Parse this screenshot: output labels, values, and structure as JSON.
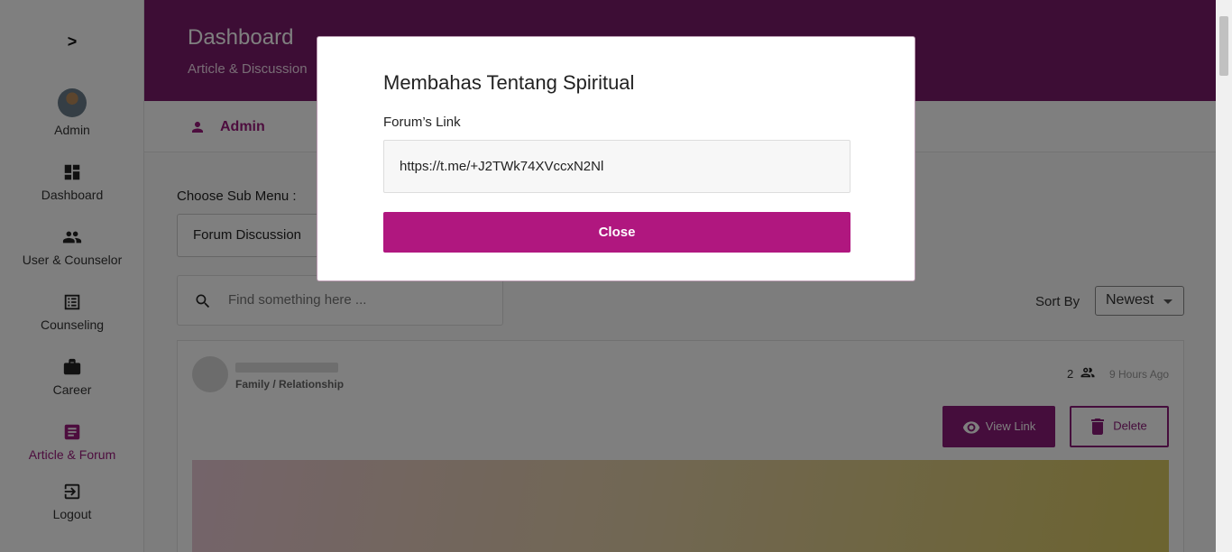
{
  "sidebar": {
    "toggle_glyph": ">",
    "items": [
      {
        "label": "Admin",
        "icon": "avatar"
      },
      {
        "label": "Dashboard",
        "icon": "dashboard-icon"
      },
      {
        "label": "User & Counselor",
        "icon": "people-icon"
      },
      {
        "label": "Counseling",
        "icon": "list-icon"
      },
      {
        "label": "Career",
        "icon": "briefcase-icon"
      },
      {
        "label": "Article & Forum",
        "icon": "article-icon",
        "active": true
      },
      {
        "label": "Logout",
        "icon": "logout-icon"
      }
    ]
  },
  "header": {
    "title": "Dashboard",
    "subtitle": "Article & Discussion"
  },
  "userbar": {
    "name": "Admin"
  },
  "content": {
    "submenu_label": "Choose Sub Menu :",
    "submenu_value": "Forum Discussion",
    "search_placeholder": "Find something here ...",
    "sort_label": "Sort By",
    "sort_value": "Newest"
  },
  "card": {
    "category": "Family / Relationship",
    "members": "2",
    "time": "9 Hours Ago",
    "view_label": "View Link",
    "delete_label": "Delete"
  },
  "modal": {
    "title": "Membahas Tentang Spiritual",
    "field_label": "Forum’s Link",
    "link_value": "https://t.me/+J2TWk74XVccxN2Nl",
    "close_label": "Close"
  },
  "colors": {
    "brand": "#9b1b7d",
    "header_bg": "#7a1a6a",
    "close_button": "#b0177f"
  }
}
